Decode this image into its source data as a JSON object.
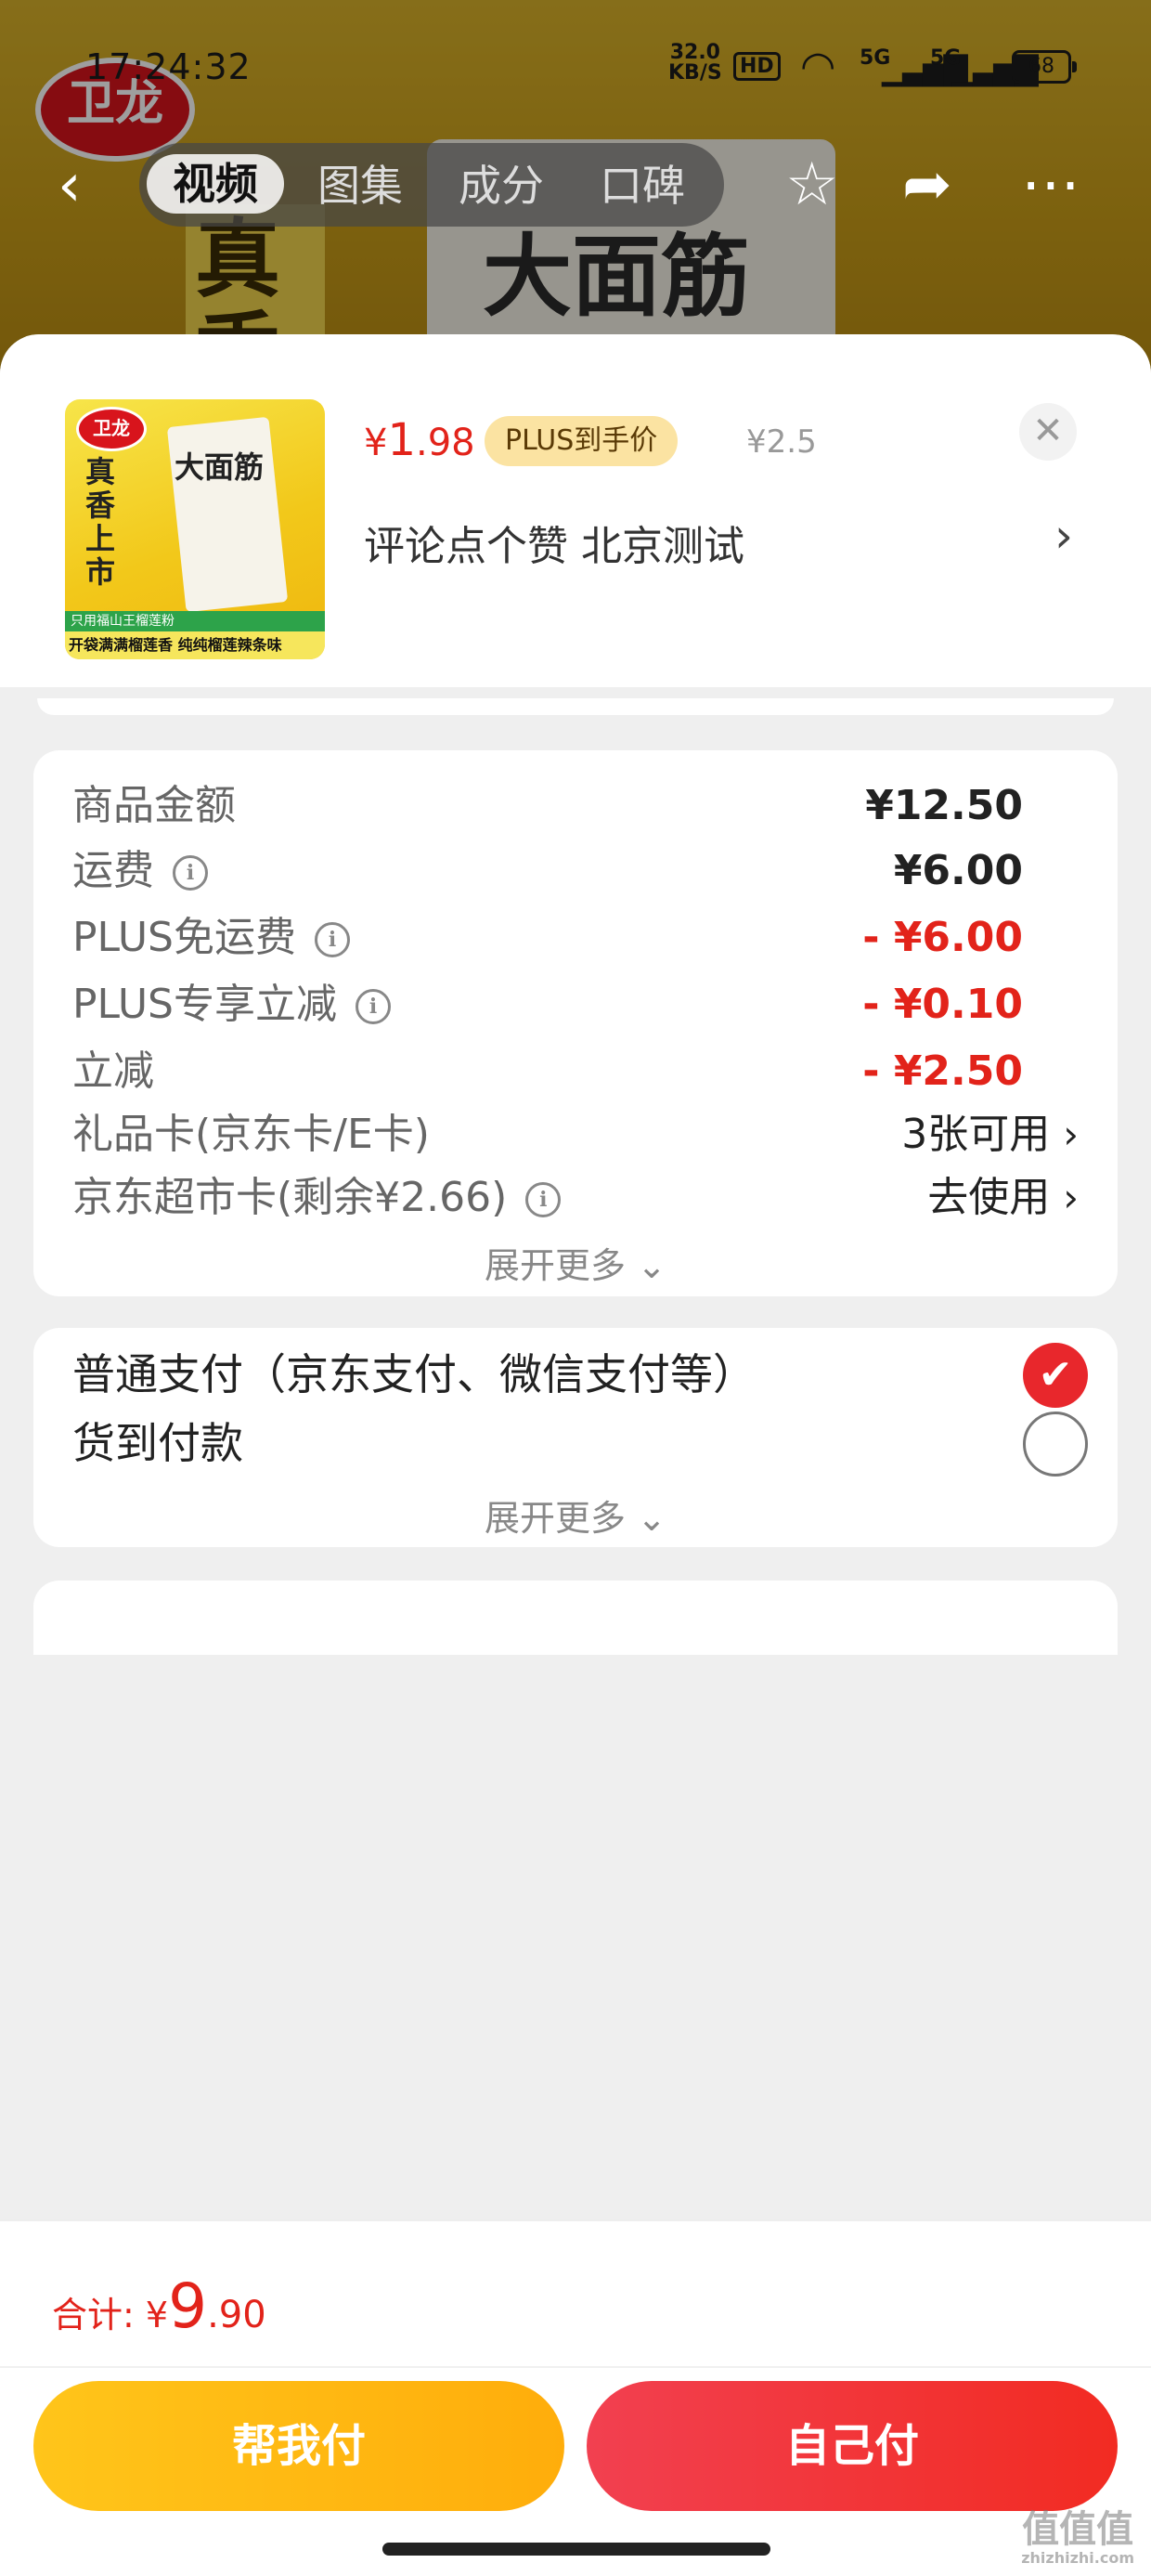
{
  "status_bar": {
    "time": "17:24:32",
    "net_speed": "32.0",
    "net_unit": "KB/S",
    "hd": "HD",
    "sim1": "5G",
    "sim2": "5G",
    "battery": "68"
  },
  "header": {
    "tabs": [
      "视频",
      "图集",
      "成分",
      "口碑"
    ],
    "active_tab": "视频"
  },
  "background_product": {
    "brand": "卫龙",
    "title": "大面筋",
    "side_text": "真香"
  },
  "product": {
    "thumb_brand": "卫龙",
    "thumb_name": "大面筋",
    "thumb_side": "真香上市",
    "thumb_band1": "只用福山王榴莲粉",
    "thumb_band2": "开袋满满榴莲香 纯纯榴莲辣条味",
    "price_symbol": "¥",
    "price_int": "1",
    "price_dec": ".98",
    "plus_badge": "PLUS到手价",
    "original_price": "¥2.5",
    "description": "评论点个赞 北京测试"
  },
  "summary": {
    "rows": [
      {
        "label": "商品金额",
        "value": "¥12.50"
      },
      {
        "label": "运费",
        "value": "¥6.00"
      },
      {
        "label": "PLUS免运费",
        "value": "- ¥6.00"
      },
      {
        "label": "PLUS专享立减",
        "value": "- ¥0.10"
      },
      {
        "label": "立减",
        "value": "- ¥2.50"
      },
      {
        "label": "礼品卡(京东卡/E卡)",
        "value": "3张可用"
      },
      {
        "label": "京东超市卡(剩余¥2.66)",
        "value": "去使用"
      }
    ],
    "expand_more": "展开更多 ⌄"
  },
  "payment": {
    "options": [
      {
        "label": "普通支付（京东支付、微信支付等）",
        "selected": true
      },
      {
        "label": "货到付款",
        "selected": false
      }
    ],
    "expand_more": "展开更多 ⌄"
  },
  "bottom": {
    "total_label": "合计:",
    "total_symbol": "¥",
    "total_int": "9",
    "total_dec": ".90",
    "help_pay": "帮我付",
    "self_pay": "自己付"
  },
  "watermark": {
    "text": "值值值",
    "site": "zhizhizhi.com"
  },
  "colors": {
    "accent_red": "#e2231a",
    "button_yellow": "#ffb811",
    "button_red": "#f2352c",
    "plus_badge_bg": "#fbe3a2"
  }
}
